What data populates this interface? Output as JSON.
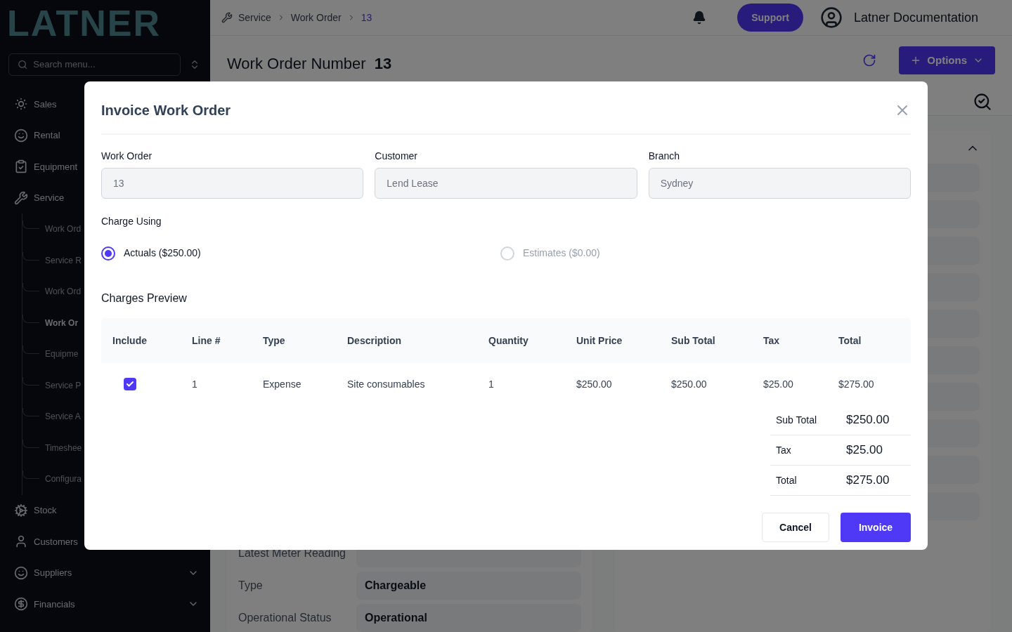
{
  "logo": "LATNER",
  "sidebar": {
    "search": {
      "placeholder": "Search menu..."
    },
    "items": [
      {
        "label": "Sales"
      },
      {
        "label": "Rental"
      },
      {
        "label": "Equipment"
      },
      {
        "label": "Service",
        "children": [
          {
            "label": "Work Ord",
            "selected": false
          },
          {
            "label": "Service R",
            "selected": false
          },
          {
            "label": "Work Ord",
            "selected": false
          },
          {
            "label": "Work Or",
            "selected": true
          },
          {
            "label": "Equipme",
            "selected": false
          },
          {
            "label": "Service P",
            "selected": false
          },
          {
            "label": "Service A",
            "selected": false
          },
          {
            "label": "Timeshee",
            "selected": false
          },
          {
            "label": "Configura",
            "selected": false
          }
        ]
      },
      {
        "label": "Stock"
      },
      {
        "label": "Customers"
      },
      {
        "label": "Suppliers",
        "expanded": false
      },
      {
        "label": "Financials",
        "expanded": false
      }
    ]
  },
  "breadcrumb": [
    "Service",
    "Work Order",
    "13"
  ],
  "header": {
    "support": "Support",
    "user": "Latner Documentation"
  },
  "page": {
    "title": "Work Order Number",
    "number": "13",
    "options": "Options",
    "fields": [
      {
        "label": "Latest Meter Reading"
      },
      {
        "label": "Type",
        "value": "Chargeable"
      },
      {
        "label": "Operational Status",
        "value": "Operational"
      }
    ]
  },
  "dialog": {
    "title": "Invoice Work Order",
    "fields": [
      {
        "label": "Work Order",
        "value": "13"
      },
      {
        "label": "Customer",
        "value": "Lend Lease"
      },
      {
        "label": "Branch",
        "value": "Sydney"
      }
    ],
    "charge_using": {
      "label": "Charge Using",
      "options": [
        {
          "label": "Actuals ($250.00)",
          "selected": true
        },
        {
          "label": "Estimates ($0.00)",
          "selected": false
        }
      ]
    },
    "preview_title": "Charges Preview",
    "table": {
      "columns": [
        "Include",
        "Line #",
        "Type",
        "Description",
        "Quantity",
        "Unit Price",
        "Sub Total",
        "Tax",
        "Total"
      ],
      "rows": [
        {
          "include": true,
          "cells": [
            "",
            "1",
            "Expense",
            "Site consumables",
            "1",
            "$250.00",
            "$250.00",
            "$25.00",
            "$275.00"
          ]
        }
      ]
    },
    "totals": [
      {
        "label": "Sub Total",
        "value": "$250.00"
      },
      {
        "label": "Tax",
        "value": "$25.00"
      },
      {
        "label": "Total",
        "value": "$275.00"
      }
    ],
    "buttons": {
      "cancel": "Cancel",
      "invoice": "Invoice"
    }
  }
}
